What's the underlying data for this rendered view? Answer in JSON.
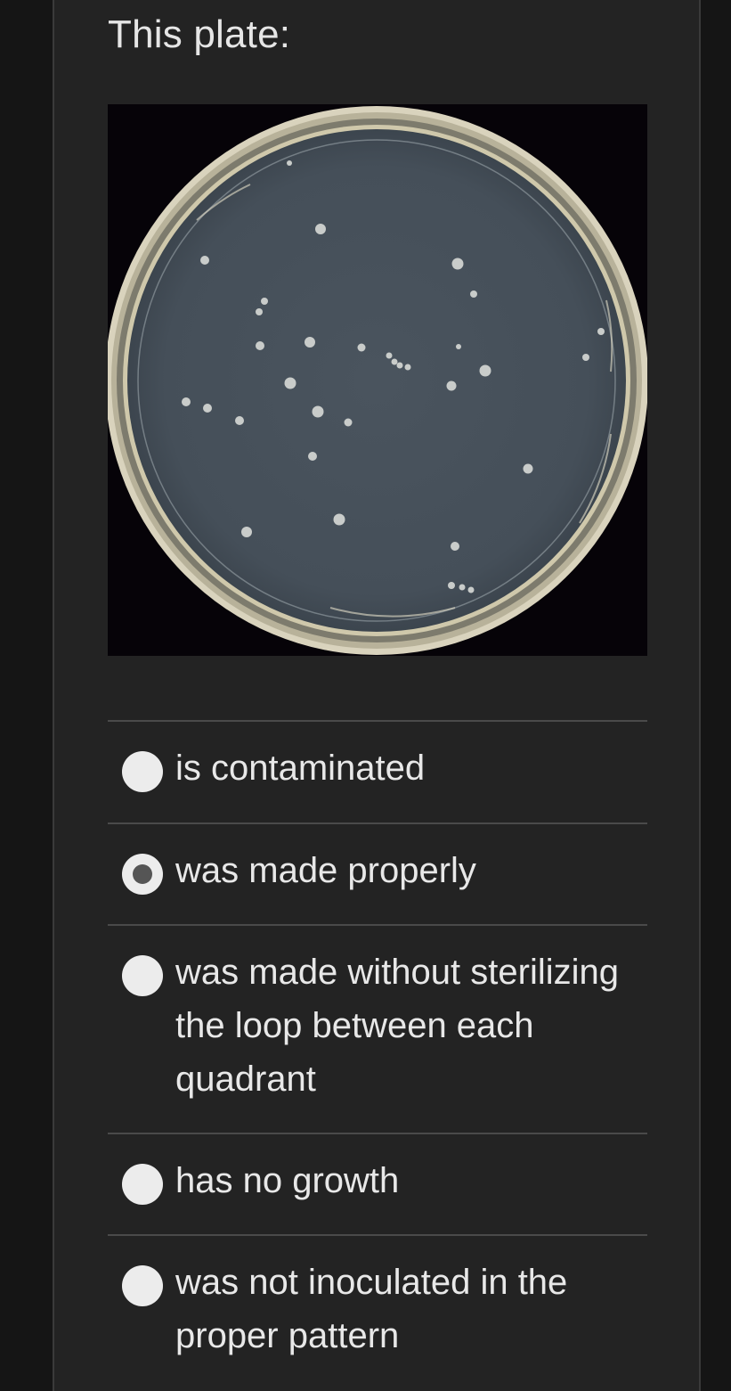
{
  "question": {
    "text": "This plate:"
  },
  "image": {
    "subject": "agar-petri-dish-with-scattered-colonies"
  },
  "options": [
    {
      "label": "is contaminated",
      "selected": false
    },
    {
      "label": "was made properly",
      "selected": true
    },
    {
      "label": "was made without sterilizing the loop between each quadrant",
      "selected": false
    },
    {
      "label": "has no growth",
      "selected": false
    },
    {
      "label": "was not inoculated in the proper pattern",
      "selected": false
    }
  ],
  "colors": {
    "background": "#232323",
    "text": "#e8e8e8",
    "divider": "#4a4a4a",
    "radio_fill": "#ececec",
    "radio_selected_dot": "#555555"
  }
}
